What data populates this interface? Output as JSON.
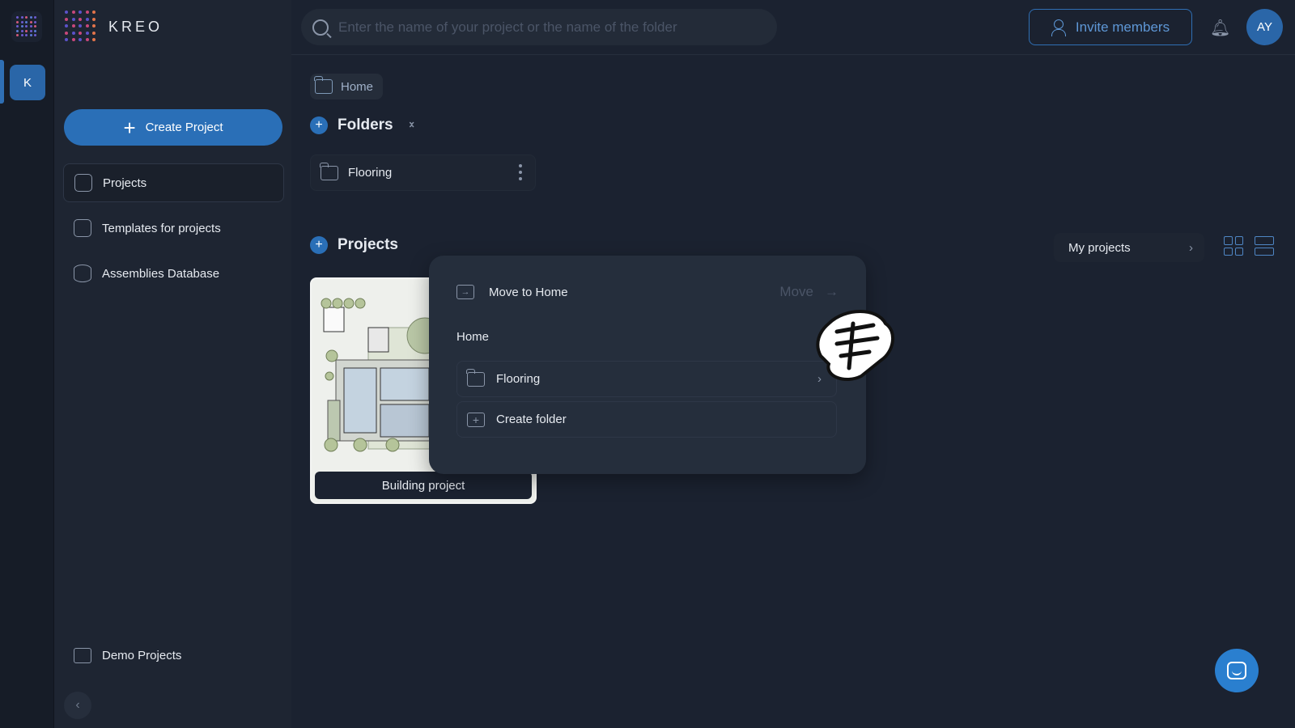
{
  "app": {
    "brand": "KREO",
    "company_initial": "K",
    "user_initials": "AY"
  },
  "search": {
    "placeholder": "Enter the name of your project or the name of the folder",
    "value": ""
  },
  "header": {
    "invite_label": "Invite members"
  },
  "sidebar": {
    "create_label": "Create Project",
    "items": [
      {
        "label": "Projects",
        "icon": "document-icon",
        "active": true
      },
      {
        "label": "Templates for projects",
        "icon": "templates-icon",
        "active": false
      },
      {
        "label": "Assemblies Database",
        "icon": "database-icon",
        "active": false
      }
    ],
    "demo_label": "Demo Projects"
  },
  "breadcrumb": {
    "label": "Home"
  },
  "folders": {
    "title": "Folders",
    "items": [
      {
        "name": "Flooring"
      }
    ]
  },
  "projects": {
    "title": "Projects",
    "filter_label": "My projects",
    "items": [
      {
        "name": "Building project"
      }
    ]
  },
  "move_dialog": {
    "title": "Move to Home",
    "action_label": "Move",
    "current_location": "Home",
    "folders": [
      {
        "name": "Flooring"
      }
    ],
    "create_folder_label": "Create folder"
  },
  "colors": {
    "accent": "#2a6fb7",
    "background": "#1b2230",
    "sidebar": "#1e2532",
    "popup": "#252e3c"
  }
}
